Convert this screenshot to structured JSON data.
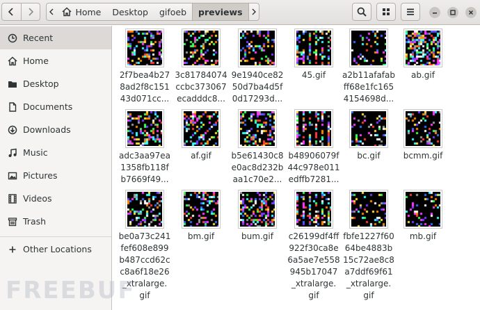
{
  "header": {
    "path": [
      "Home",
      "Desktop",
      "gifoeb",
      "previews"
    ],
    "icons": {
      "back": "chevron-left-icon",
      "forward": "chevron-right-icon",
      "search": "search-icon",
      "view": "grid-view-icon",
      "menu": "hamburger-menu-icon",
      "minimize": "minimize-icon",
      "maximize": "maximize-icon",
      "close": "close-icon"
    }
  },
  "sidebar": {
    "items": [
      {
        "label": "Recent",
        "icon": "clock-icon"
      },
      {
        "label": "Home",
        "icon": "home-icon"
      },
      {
        "label": "Desktop",
        "icon": "folder-icon"
      },
      {
        "label": "Documents",
        "icon": "document-icon"
      },
      {
        "label": "Downloads",
        "icon": "download-icon"
      },
      {
        "label": "Music",
        "icon": "music-note-icon"
      },
      {
        "label": "Pictures",
        "icon": "picture-icon"
      },
      {
        "label": "Videos",
        "icon": "film-icon"
      },
      {
        "label": "Trash",
        "icon": "trash-icon"
      }
    ],
    "other": {
      "label": "Other Locations",
      "icon": "plus-icon"
    }
  },
  "files": [
    {
      "name": "2f7bea4b27\n8ad2f8c151\n43d071cc...",
      "pattern": "noise"
    },
    {
      "name": "3c81784074\nccbc373067\necadddc8...",
      "pattern": "diag"
    },
    {
      "name": "9e1940ce82\n50d7ba4d5f\n0d17293d...",
      "pattern": "noise"
    },
    {
      "name": "45.gif",
      "pattern": "stripes"
    },
    {
      "name": "a2b11afafab\nff68e1fc165\n4154698d...",
      "pattern": "sparse"
    },
    {
      "name": "ab.gif",
      "pattern": "dense"
    },
    {
      "name": "adc3aa97ea\n1358fb118f\nb7669f49...",
      "pattern": "noise"
    },
    {
      "name": "af.gif",
      "pattern": "diag"
    },
    {
      "name": "b5e61430c8\ne0ac8d232b\naa1c70e2...",
      "pattern": "noise"
    },
    {
      "name": "b48906079f\n44c978e011\nedffb7281...",
      "pattern": "stripes"
    },
    {
      "name": "bc.gif",
      "pattern": "sparse"
    },
    {
      "name": "bcmm.gif",
      "pattern": "sparse"
    },
    {
      "name": "be0a73c241\nfef608e899\nb487ccd62c\nc8a6f18e26\n_xtralarge.\ngif",
      "pattern": "diag"
    },
    {
      "name": "bm.gif",
      "pattern": "noise"
    },
    {
      "name": "bum.gif",
      "pattern": "weave"
    },
    {
      "name": "c26199df4ff\n922f30ca8e\n6a5ae7e558\n945b17047\n_xtralarge.\ngif",
      "pattern": "stripes"
    },
    {
      "name": "fbfe1227f60\n64be4883b\n15c72ae8c8\na7ddf69f61\n_xtralarge.\ngif",
      "pattern": "sparse"
    },
    {
      "name": "mb.gif",
      "pattern": "sparse"
    }
  ],
  "watermark": "FREEBUF"
}
